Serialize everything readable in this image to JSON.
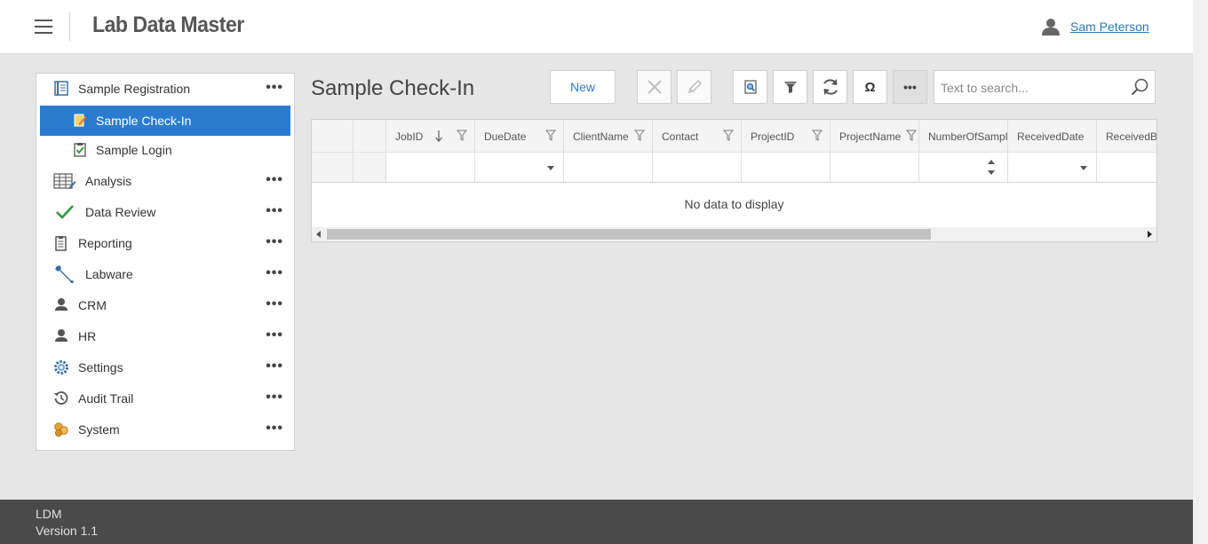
{
  "header": {
    "app_title": "Lab Data Master",
    "user_name": "Sam Peterson"
  },
  "sidebar": {
    "items": [
      {
        "label": "Sample Registration",
        "icon": "registration-icon",
        "has_menu": true
      },
      {
        "label": "Sample Check-In",
        "icon": "check-in-icon",
        "active": true
      },
      {
        "label": "Sample Login",
        "icon": "login-checklist-icon"
      },
      {
        "label": "Analysis",
        "icon": "spreadsheet-icon",
        "has_menu": true
      },
      {
        "label": "Data Review",
        "icon": "checkmark-icon",
        "has_menu": true
      },
      {
        "label": "Reporting",
        "icon": "clipboard-icon",
        "has_menu": true
      },
      {
        "label": "Labware",
        "icon": "wrench-icon",
        "has_menu": true
      },
      {
        "label": "CRM",
        "icon": "person-icon",
        "has_menu": true
      },
      {
        "label": "HR",
        "icon": "person-icon",
        "has_menu": true
      },
      {
        "label": "Settings",
        "icon": "gear-icon",
        "has_menu": true
      },
      {
        "label": "Audit Trail",
        "icon": "history-icon",
        "has_menu": true
      },
      {
        "label": "System",
        "icon": "system-icon",
        "has_menu": true
      }
    ],
    "more_glyph": "•••"
  },
  "main": {
    "title": "Sample Check-In",
    "toolbar": {
      "new_label": "New",
      "omega_label": "Ω",
      "more_label": "•••"
    },
    "search": {
      "placeholder": "Text to search...",
      "value": ""
    },
    "grid": {
      "columns": [
        "JobID",
        "DueDate",
        "ClientName",
        "Contact",
        "ProjectID",
        "ProjectName",
        "NumberOfSampl",
        "ReceivedDate",
        "ReceivedBy"
      ],
      "empty_text": "No data to display"
    }
  },
  "footer": {
    "app_short": "LDM",
    "version": "Version 1.1"
  },
  "colors": {
    "accent": "#2b7bd0",
    "link": "#2a7ab8",
    "footer_bg": "#4a4a4a",
    "page_bg": "#e6e6e6"
  }
}
